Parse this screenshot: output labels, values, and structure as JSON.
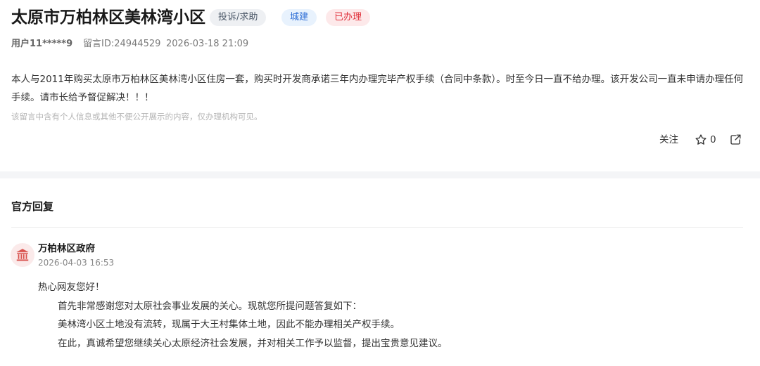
{
  "post": {
    "title": "太原市万柏林区美林湾小区",
    "tags": {
      "type": "投诉/求助",
      "domain": "城建",
      "status": "已办理"
    },
    "user": "用户11*****9",
    "message_id": "留言ID:24944529",
    "time": "2026-03-18 21:09",
    "content": "本人与2011年购买太原市万柏林区美林湾小区住房一套，购买时开发商承诺三年内办理完毕产权手续（合同中条款）。时至今日一直不给办理。该开发公司一直未申请办理任何手续。请市长给予督促解决！！！",
    "privacy_notice": "该留言中含有个人信息或其他不便公开展示的内容，仅办理机构可见。",
    "actions": {
      "follow_label": "关注",
      "like_count": "0",
      "like_icon": "star-outline-icon",
      "share_icon": "share-icon"
    }
  },
  "official_reply": {
    "section_title": "官方回复",
    "org_icon": "government-building-icon",
    "org_name": "万柏林区政府",
    "time": "2026-04-03 16:53",
    "greeting": "热心网友您好！",
    "paragraphs": [
      "首先非常感谢您对太原社会事业发展的关心。现就您所提问题答复如下：",
      "美林湾小区土地没有流转，现属于大王村集体土地，因此不能办理相关产权手续。",
      "在此，真诚希望您继续关心太原经济社会发展，并对相关工作予以监督，提出宝贵意见建议。"
    ]
  },
  "colors": {
    "status_red": "#e0323c",
    "domain_blue": "#2f6fd6",
    "avatar_red": "#d9534f"
  }
}
